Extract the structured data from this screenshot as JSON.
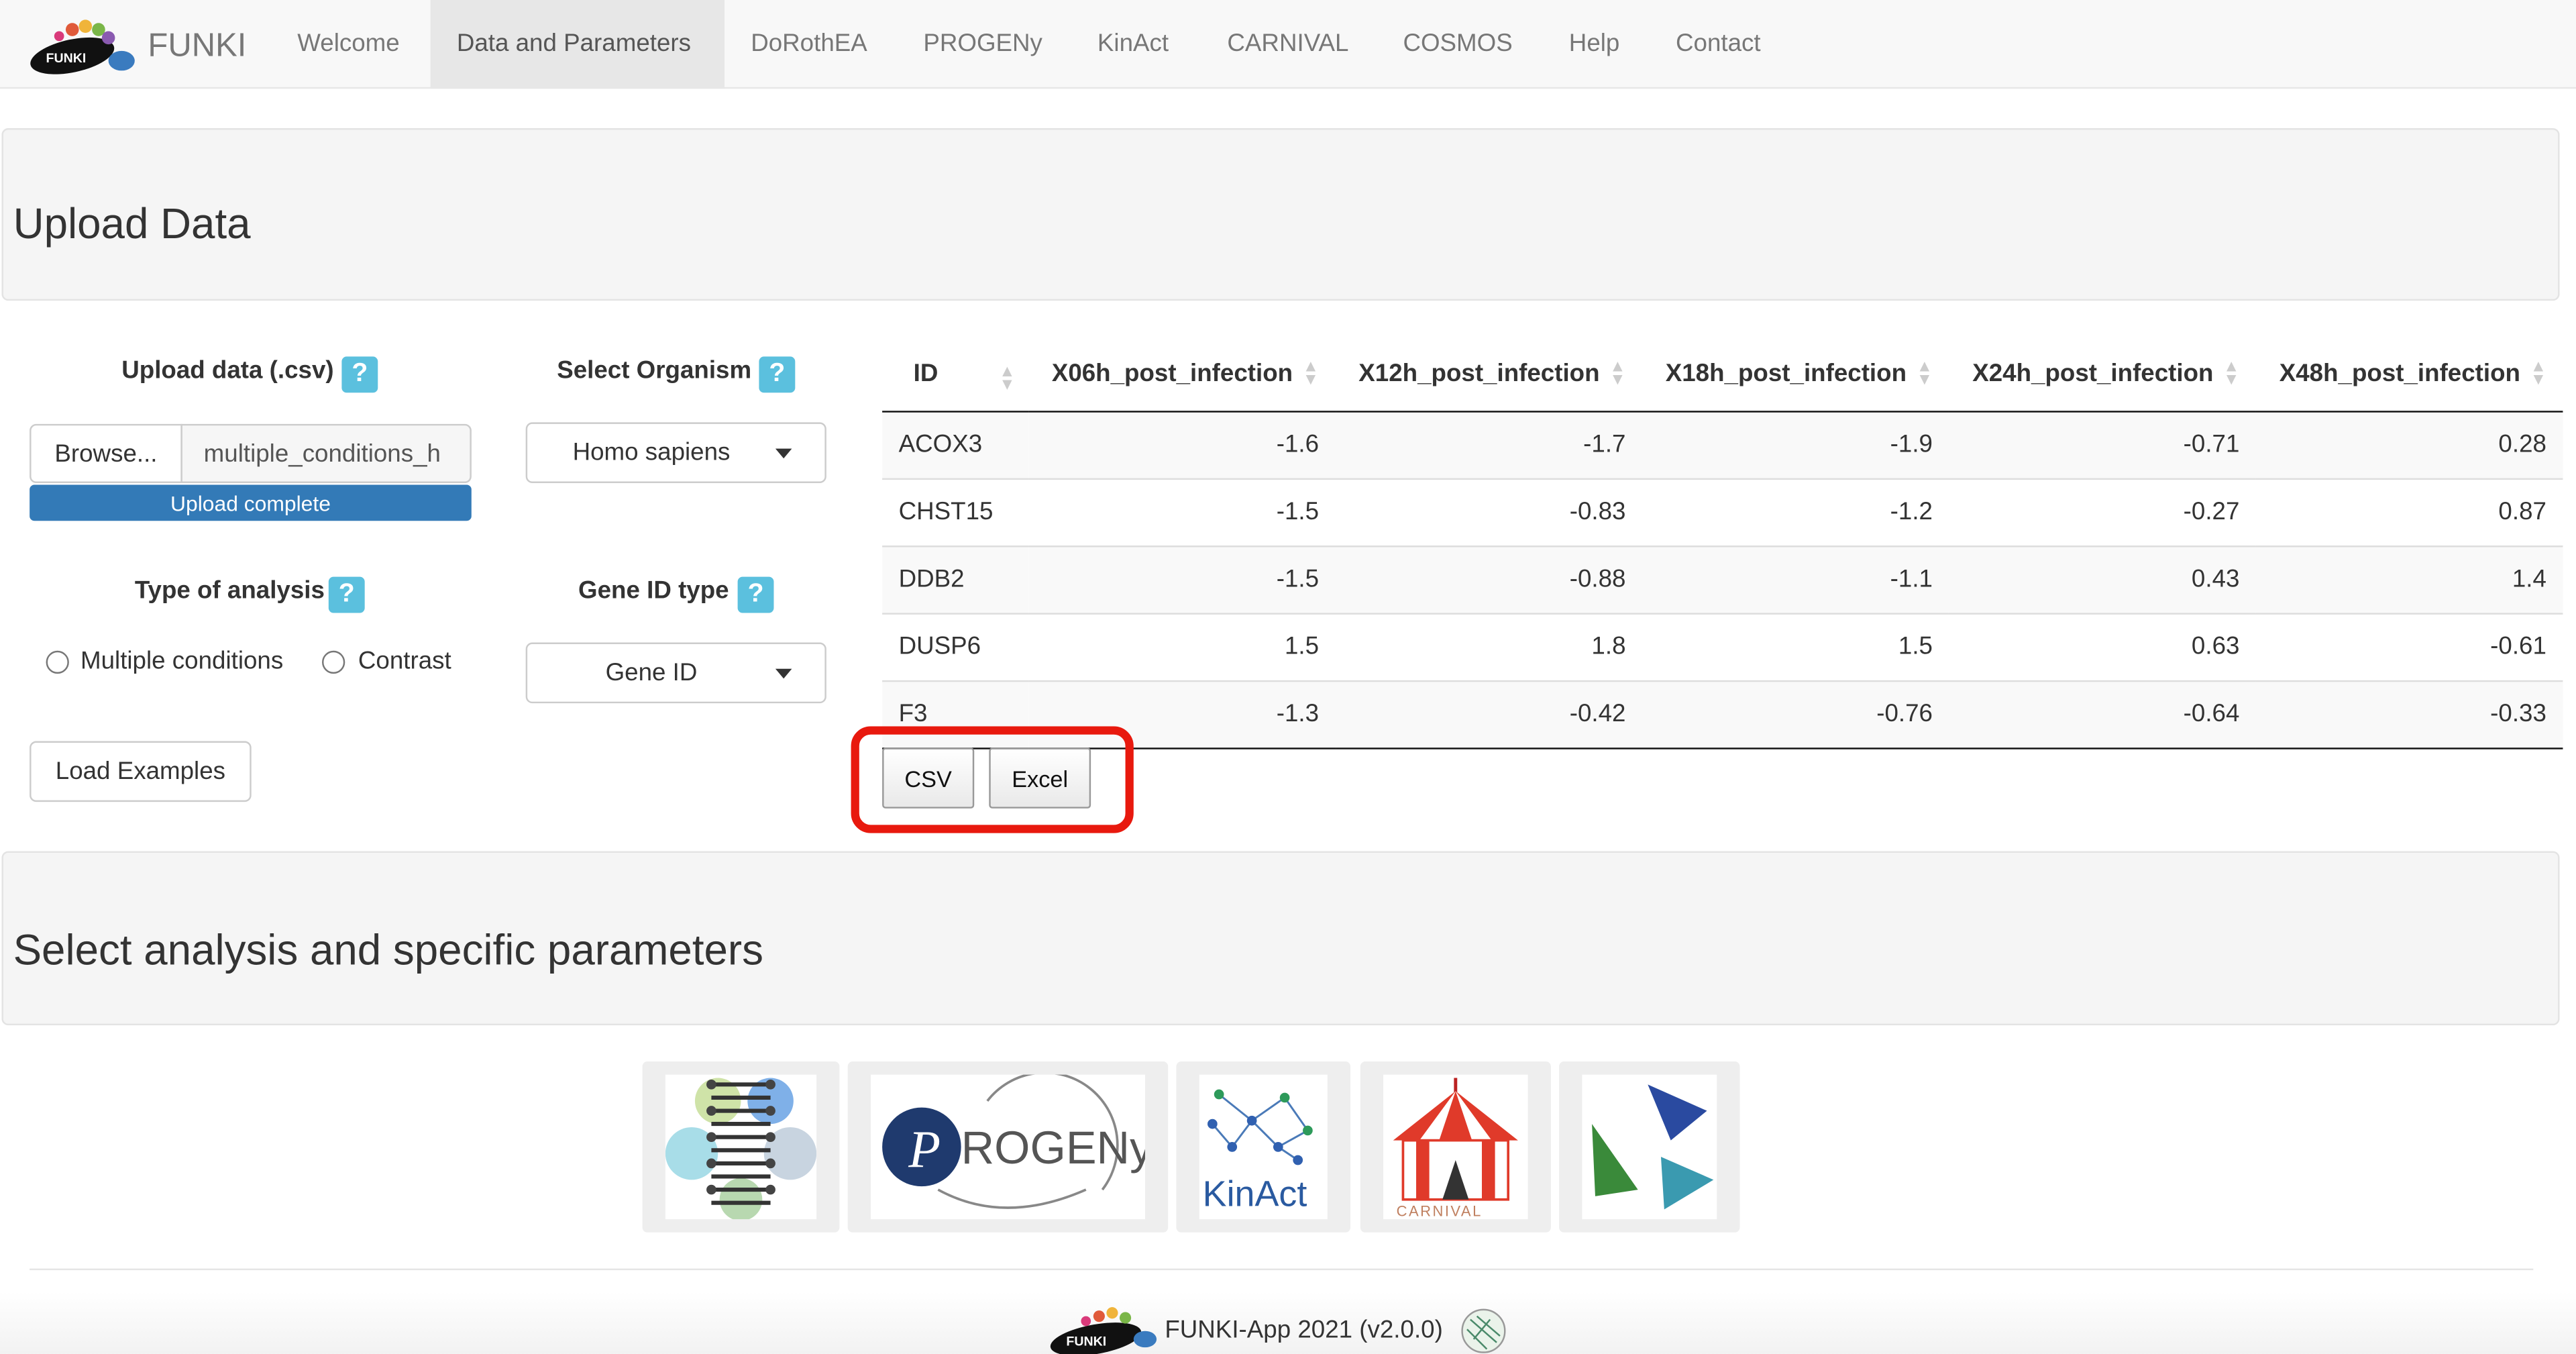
{
  "nav": {
    "brand": "FUNKI",
    "logo_text": "FUNKI",
    "items": [
      {
        "label": "Welcome"
      },
      {
        "label": "Data and Parameters"
      },
      {
        "label": "DoRothEA"
      },
      {
        "label": "PROGENy"
      },
      {
        "label": "KinAct"
      },
      {
        "label": "CARNIVAL"
      },
      {
        "label": "COSMOS"
      },
      {
        "label": "Help"
      },
      {
        "label": "Contact"
      }
    ],
    "active": "Data and Parameters"
  },
  "upload_section": {
    "title": "Upload Data",
    "upload_label": "Upload data (.csv)",
    "help_glyph": "?",
    "browse_label": "Browse...",
    "file_name": "multiple_conditions_h",
    "progress_text": "Upload complete",
    "progress_fraction": 1.0,
    "organism_label": "Select Organism",
    "organism_value": "Homo sapiens",
    "analysis_type_label": "Type of analysis",
    "analysis_options": [
      "Multiple conditions",
      "Contrast"
    ],
    "gene_id_label": "Gene ID type",
    "gene_id_value": "Gene ID",
    "load_examples_label": "Load Examples"
  },
  "table": {
    "columns": [
      "ID",
      "X06h_post_infection",
      "X12h_post_infection",
      "X18h_post_infection",
      "X24h_post_infection",
      "X48h_post_infection"
    ],
    "rows": [
      [
        "ACOX3",
        "-1.6",
        "-1.7",
        "-1.9",
        "-0.71",
        "0.28"
      ],
      [
        "CHST15",
        "-1.5",
        "-0.83",
        "-1.2",
        "-0.27",
        "0.87"
      ],
      [
        "DDB2",
        "-1.5",
        "-0.88",
        "-1.1",
        "0.43",
        "1.4"
      ],
      [
        "DUSP6",
        "1.5",
        "1.8",
        "1.5",
        "0.63",
        "-0.61"
      ],
      [
        "F3",
        "-1.3",
        "-0.42",
        "-0.76",
        "-0.64",
        "-0.33"
      ]
    ],
    "export_buttons": [
      "CSV",
      "Excel"
    ],
    "highlight_color": "#e8190e"
  },
  "analysis_section": {
    "title": "Select analysis and specific parameters",
    "tools": [
      {
        "name": "DoRothEA",
        "icon": "dna-icon",
        "logo_text": ""
      },
      {
        "name": "PROGENy",
        "icon": "progeny-logo",
        "logo_text": "ROGENy"
      },
      {
        "name": "KinAct",
        "icon": "kinact-network-icon",
        "logo_text": "KinAct"
      },
      {
        "name": "CARNIVAL",
        "icon": "carnival-tent-icon",
        "logo_text": "CARNIVAL"
      },
      {
        "name": "COSMOS",
        "icon": "cosmos-triangles-icon",
        "logo_text": ""
      }
    ]
  },
  "footer": {
    "logo_text": "FUNKI",
    "text": "FUNKI-App 2021 (v2.0.0)"
  },
  "colors": {
    "accent": "#337ab7",
    "help": "#5bc0de",
    "highlight": "#e8190e"
  }
}
